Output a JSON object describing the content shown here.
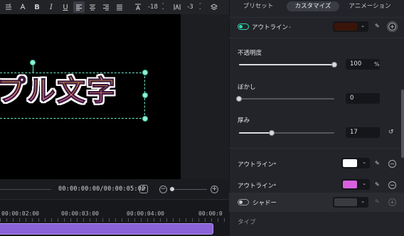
{
  "toolbar": {
    "font_size": "-18",
    "spacing": "-3"
  },
  "playback": {
    "timecode": "00:00:00:00/00:00:05:00"
  },
  "timeline": {
    "ruler_labels": [
      "00:00:02:00",
      "00:00:03:00",
      "00:00:04:00",
      "00:00:0"
    ]
  },
  "preview": {
    "title_text": "プル文字"
  },
  "tabs": {
    "preset": "プリセット",
    "customize": "カスタマイズ",
    "animation": "アニメーション"
  },
  "outline_header": {
    "label": "アウトライン",
    "color": "#3a1408"
  },
  "opacity": {
    "label": "不透明度",
    "value": "100",
    "unit": "%",
    "fraction": 1.0
  },
  "blur": {
    "label": "ぼかし",
    "value": "0",
    "fraction": 0.0
  },
  "thickness": {
    "label": "厚み",
    "value": "17",
    "fraction": 0.34
  },
  "outline_1": {
    "label": "アウトライン",
    "color": "#ffffff"
  },
  "outline_2": {
    "label": "アウトライン",
    "color": "#d860e0"
  },
  "shadow": {
    "label": "シャドー",
    "color": "#3a3b40"
  },
  "type": {
    "label": "タイプ"
  },
  "colors": {
    "accent": "#2fd8b0",
    "clip": "#8a63d6",
    "selection": "#6fe3c6"
  }
}
